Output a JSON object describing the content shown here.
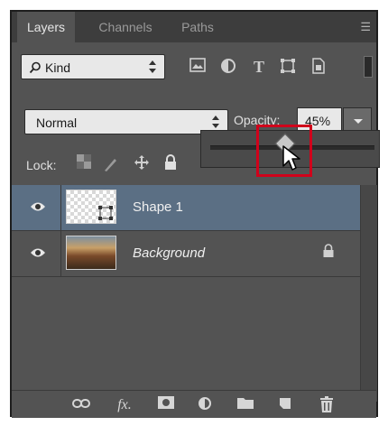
{
  "tabs": [
    {
      "label": "Layers",
      "active": true
    },
    {
      "label": "Channels",
      "active": false
    },
    {
      "label": "Paths",
      "active": false
    }
  ],
  "filter": {
    "kind_label": "Kind",
    "filter_icons": [
      "image-filter-icon",
      "adjustment-filter-icon",
      "type-filter-icon",
      "shape-filter-icon",
      "smart-object-filter-icon"
    ]
  },
  "blend_mode": "Normal",
  "opacity": {
    "label": "Opacity:",
    "value": "45%",
    "slider_level": 0.45
  },
  "lock": {
    "label": "Lock:"
  },
  "layers": [
    {
      "name": "Shape 1",
      "visible": true,
      "selected": true,
      "locked": false
    },
    {
      "name": "Background",
      "visible": true,
      "selected": false,
      "locked": true
    }
  ],
  "bottom_icons": [
    "link-layers-icon",
    "fx-icon",
    "add-mask-icon",
    "adjustment-layer-icon",
    "new-group-icon",
    "new-layer-icon",
    "trash-icon"
  ],
  "colors": {
    "panel": "#535353",
    "selected_row": "#5b6f84",
    "highlight_box": "#d0021b"
  }
}
